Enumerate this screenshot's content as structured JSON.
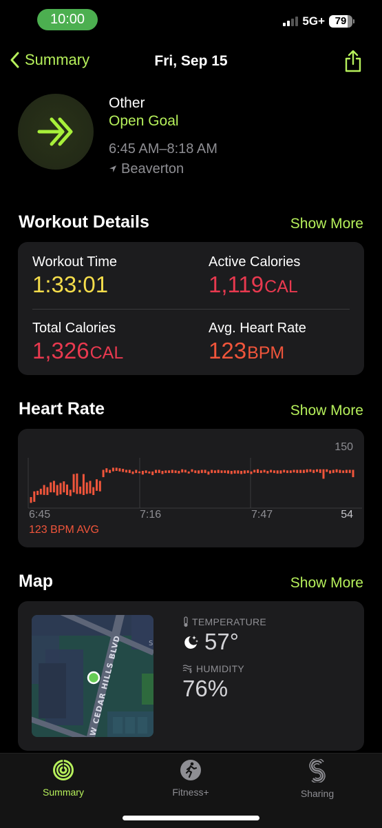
{
  "status_bar": {
    "time": "10:00",
    "network": "5G+",
    "battery_level": "79",
    "battery_fraction": 0.79,
    "signal_bars_active": 2,
    "signal_bars_total": 4
  },
  "nav": {
    "back_label": "Summary",
    "title": "Fri, Sep 15",
    "share_icon": "share-icon"
  },
  "workout": {
    "icon": "double-chevron-arrow-icon",
    "type": "Other",
    "goal": "Open Goal",
    "time_range": "6:45 AM–8:18 AM",
    "location_icon": "location-arrow-icon",
    "location": "Beaverton"
  },
  "details": {
    "title": "Workout Details",
    "show_more": "Show More",
    "metrics": [
      {
        "label": "Workout Time",
        "value": "1:33:01",
        "unit": "",
        "color": "#f5dd4b"
      },
      {
        "label": "Active Calories",
        "value": "1,119",
        "unit": "CAL",
        "color": "#e8394f"
      },
      {
        "label": "Total Calories",
        "value": "1,326",
        "unit": "CAL",
        "color": "#e8394f"
      },
      {
        "label": "Avg. Heart Rate",
        "value": "123",
        "unit": "BPM",
        "color": "#f0553b"
      }
    ]
  },
  "heart_rate": {
    "title": "Heart Rate",
    "show_more": "Show More",
    "avg_label": "123 BPM AVG",
    "max_label": "150",
    "min_label": "54",
    "x_ticks": [
      "6:45",
      "7:16",
      "7:47"
    ]
  },
  "chart_data": {
    "type": "bar",
    "title": "Heart Rate",
    "xlabel": "",
    "ylabel": "BPM",
    "ylim": [
      54,
      150
    ],
    "x_ticks": [
      "6:45",
      "7:16",
      "7:47"
    ],
    "bar_color": "#f0553b",
    "annotation": "123 BPM AVG",
    "series": [
      {
        "name": "Heart Rate range (min,max BPM)",
        "values": [
          [
            64,
            75
          ],
          [
            66,
            86
          ],
          [
            79,
            87
          ],
          [
            80,
            91
          ],
          [
            79,
            98
          ],
          [
            79,
            94
          ],
          [
            84,
            103
          ],
          [
            84,
            106
          ],
          [
            78,
            98
          ],
          [
            80,
            102
          ],
          [
            84,
            105
          ],
          [
            79,
            99
          ],
          [
            77,
            89
          ],
          [
            84,
            119
          ],
          [
            81,
            120
          ],
          [
            81,
            95
          ],
          [
            79,
            119
          ],
          [
            81,
            103
          ],
          [
            82,
            106
          ],
          [
            79,
            94
          ],
          [
            87,
            109
          ],
          [
            86,
            106
          ],
          [
            113,
            127
          ],
          [
            122,
            130
          ],
          [
            121,
            127
          ],
          [
            124,
            131
          ],
          [
            125,
            131
          ],
          [
            124,
            130
          ],
          [
            123,
            129
          ],
          [
            122,
            127
          ],
          [
            121,
            127
          ],
          [
            119,
            124
          ],
          [
            121,
            127
          ],
          [
            121,
            124
          ],
          [
            118,
            125
          ],
          [
            121,
            126
          ],
          [
            120,
            124
          ],
          [
            117,
            124
          ],
          [
            121,
            127
          ],
          [
            121,
            127
          ],
          [
            119,
            125
          ],
          [
            121,
            126
          ],
          [
            121,
            126
          ],
          [
            121,
            127
          ],
          [
            121,
            126
          ],
          [
            120,
            125
          ],
          [
            122,
            128
          ],
          [
            122,
            127
          ],
          [
            120,
            124
          ],
          [
            123,
            128
          ],
          [
            121,
            126
          ],
          [
            120,
            126
          ],
          [
            121,
            127
          ],
          [
            121,
            127
          ],
          [
            118,
            124
          ],
          [
            121,
            127
          ],
          [
            121,
            126
          ],
          [
            121,
            127
          ],
          [
            121,
            126
          ],
          [
            121,
            126
          ],
          [
            120,
            126
          ],
          [
            119,
            125
          ],
          [
            120,
            126
          ],
          [
            120,
            126
          ],
          [
            119,
            125
          ],
          [
            120,
            126
          ],
          [
            121,
            126
          ],
          [
            119,
            124
          ],
          [
            122,
            127
          ],
          [
            121,
            128
          ],
          [
            121,
            126
          ],
          [
            122,
            127
          ],
          [
            120,
            125
          ],
          [
            122,
            127
          ],
          [
            121,
            126
          ],
          [
            120,
            126
          ],
          [
            120,
            126
          ],
          [
            122,
            127
          ],
          [
            121,
            126
          ],
          [
            121,
            126
          ],
          [
            122,
            127
          ],
          [
            121,
            127
          ],
          [
            121,
            127
          ],
          [
            121,
            127
          ],
          [
            122,
            128
          ],
          [
            123,
            128
          ],
          [
            121,
            127
          ],
          [
            123,
            128
          ],
          [
            121,
            128
          ],
          [
            110,
            128
          ],
          [
            123,
            128
          ],
          [
            120,
            126
          ],
          [
            121,
            127
          ],
          [
            122,
            128
          ],
          [
            121,
            127
          ],
          [
            121,
            126
          ],
          [
            121,
            127
          ],
          [
            121,
            127
          ],
          [
            113,
            127
          ]
        ]
      }
    ]
  },
  "map": {
    "title": "Map",
    "show_more": "Show More",
    "street_label": "W CEDAR HILLS BLVD",
    "street_label_2": "S",
    "temperature_label": "TEMPERATURE",
    "temperature_icon": "thermometer-icon",
    "weather_icon": "moon-stars-icon",
    "temperature_value": "57°",
    "humidity_label": "HUMIDITY",
    "humidity_icon": "humidity-icon",
    "humidity_value": "76%"
  },
  "tabbar": {
    "active_color": "#b6f05b",
    "inactive_color": "#8e8e93",
    "tabs": [
      {
        "label": "Summary",
        "icon": "activity-rings-icon",
        "active": true
      },
      {
        "label": "Fitness+",
        "icon": "fitness-plus-icon",
        "active": false
      },
      {
        "label": "Sharing",
        "icon": "sharing-icon",
        "active": false
      }
    ]
  }
}
